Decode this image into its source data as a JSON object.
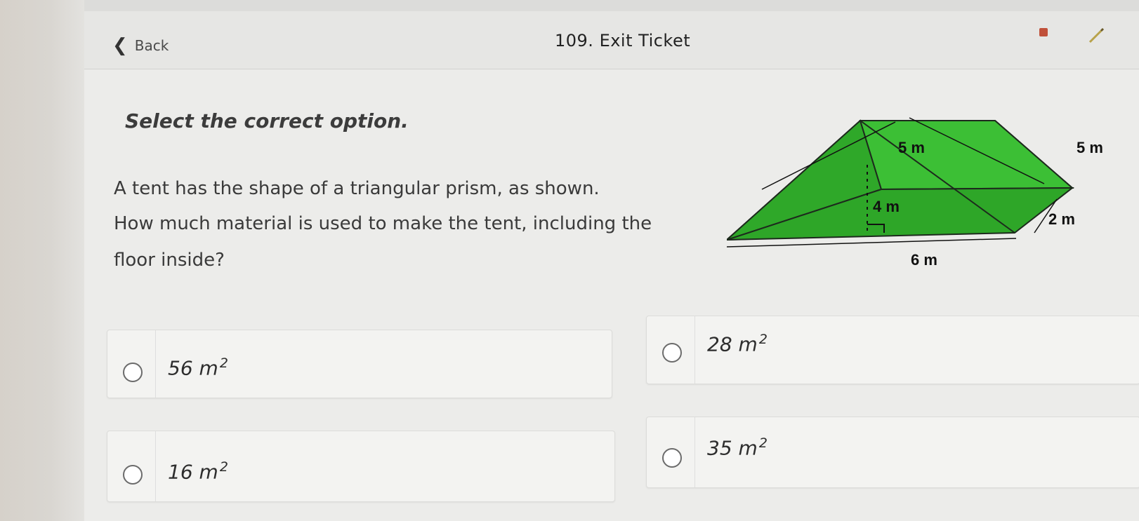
{
  "header": {
    "back_label": "Back",
    "title": "109. Exit Ticket"
  },
  "question": {
    "instruction": "Select the correct option.",
    "line1": "A tent has the shape of a triangular prism, as shown.",
    "line2": "How much material is used to make the tent, including the",
    "line3": "floor inside?"
  },
  "diagram": {
    "label_slant_left": "5 m",
    "label_slant_right": "5 m",
    "label_height": "4 m",
    "label_depth": "2 m",
    "label_base": "6 m",
    "fill_color": "#33b52d"
  },
  "options": [
    {
      "value": "56",
      "unit": "m",
      "exp": "2"
    },
    {
      "value": "28",
      "unit": "m",
      "exp": "2"
    },
    {
      "value": "16",
      "unit": "m",
      "exp": "2"
    },
    {
      "value": "35",
      "unit": "m",
      "exp": "2"
    }
  ]
}
